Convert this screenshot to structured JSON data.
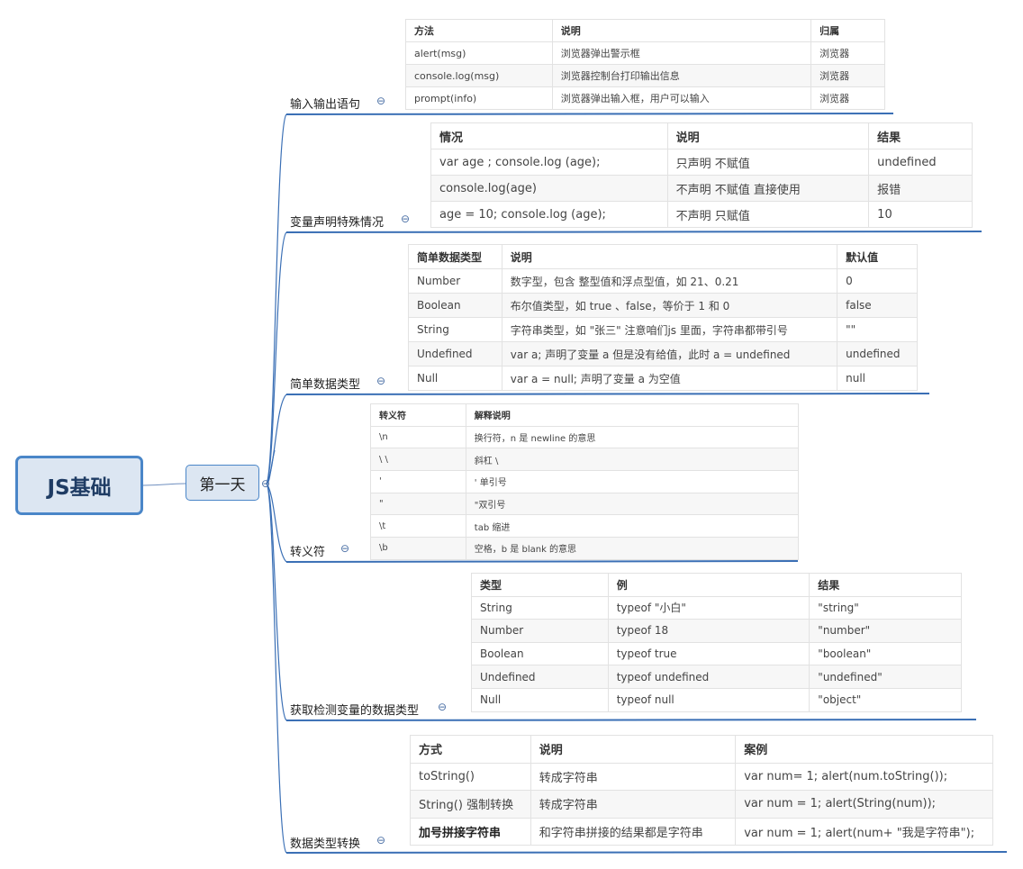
{
  "root": {
    "label": "JS基础"
  },
  "day": {
    "label": "第一天",
    "toggle": "⊖"
  },
  "branches": [
    {
      "label": "输入输出语句",
      "toggle": "⊖",
      "headers": [
        "方法",
        "说明",
        "归属"
      ],
      "rows": [
        [
          "alert(msg)",
          "浏览器弹出警示框",
          "浏览器"
        ],
        [
          "console.log(msg)",
          "浏览器控制台打印输出信息",
          "浏览器"
        ],
        [
          "prompt(info)",
          "浏览器弹出输入框，用户可以输入",
          "浏览器"
        ]
      ]
    },
    {
      "label": "变量声明特殊情况",
      "toggle": "⊖",
      "headers": [
        "情况",
        "说明",
        "结果"
      ],
      "rows": [
        [
          "var  age ; console.log (age);",
          "只声明 不赋值",
          "undefined"
        ],
        [
          "console.log(age)",
          "不声明 不赋值  直接使用",
          "报错"
        ],
        [
          "age   = 10; console.log (age);",
          "不声明   只赋值",
          "10"
        ]
      ]
    },
    {
      "label": "简单数据类型",
      "toggle": "⊖",
      "headers": [
        "简单数据类型",
        "说明",
        "默认值"
      ],
      "rows": [
        [
          "Number",
          "数字型，包含 整型值和浮点型值，如 21、0.21",
          "0"
        ],
        [
          "Boolean",
          "布尔值类型，如 true 、false，等价于 1 和 0",
          "false"
        ],
        [
          "String",
          "字符串类型，如 \"张三\"  注意咱们js 里面，字符串都带引号",
          "\"\""
        ],
        [
          "Undefined",
          "var a;   声明了变量 a 但是没有给值，此时 a = undefined",
          "undefined"
        ],
        [
          "Null",
          "var a = null;   声明了变量 a  为空值",
          "null"
        ]
      ]
    },
    {
      "label": "转义符",
      "toggle": "⊖",
      "headers": [
        "转义符",
        "解释说明"
      ],
      "rows": [
        [
          "\\n",
          "换行符，n   是    newline   的意思"
        ],
        [
          "\\ \\",
          "斜杠   \\"
        ],
        [
          "'",
          "'   单引号"
        ],
        [
          "\"",
          "\"双引号"
        ],
        [
          "\\t",
          "tab  缩进"
        ],
        [
          "\\b",
          "空格，b   是    blank   的意思"
        ]
      ]
    },
    {
      "label": "获取检测变量的数据类型",
      "toggle": "⊖",
      "headers": [
        "类型",
        "例",
        "结果"
      ],
      "rows": [
        [
          "String",
          "typeof \"小白\"",
          "\"string\""
        ],
        [
          "Number",
          "typeof 18",
          "\"number\""
        ],
        [
          "Boolean",
          "typeof true",
          "\"boolean\""
        ],
        [
          "Undefined",
          "typeof undefined",
          "\"undefined\""
        ],
        [
          "Null",
          "typeof null",
          "\"object\""
        ]
      ]
    },
    {
      "label": "数据类型转换",
      "toggle": "⊖",
      "headers": [
        "方式",
        "说明",
        "案例"
      ],
      "rows": [
        [
          "toString()",
          "转成字符串",
          "var num= 1;  alert(num.toString());"
        ],
        [
          "String() 强制转换",
          "转成字符串",
          "var num = 1;  alert(String(num));"
        ],
        [
          "加号拼接字符串",
          "和字符串拼接的结果都是字符串",
          "var num = 1;  alert(num+ \"我是字符串\");"
        ]
      ]
    }
  ],
  "colors": {
    "line": "#3a6fb5",
    "node_fill": "#dce6f2",
    "node_border": "#4a86c8"
  }
}
